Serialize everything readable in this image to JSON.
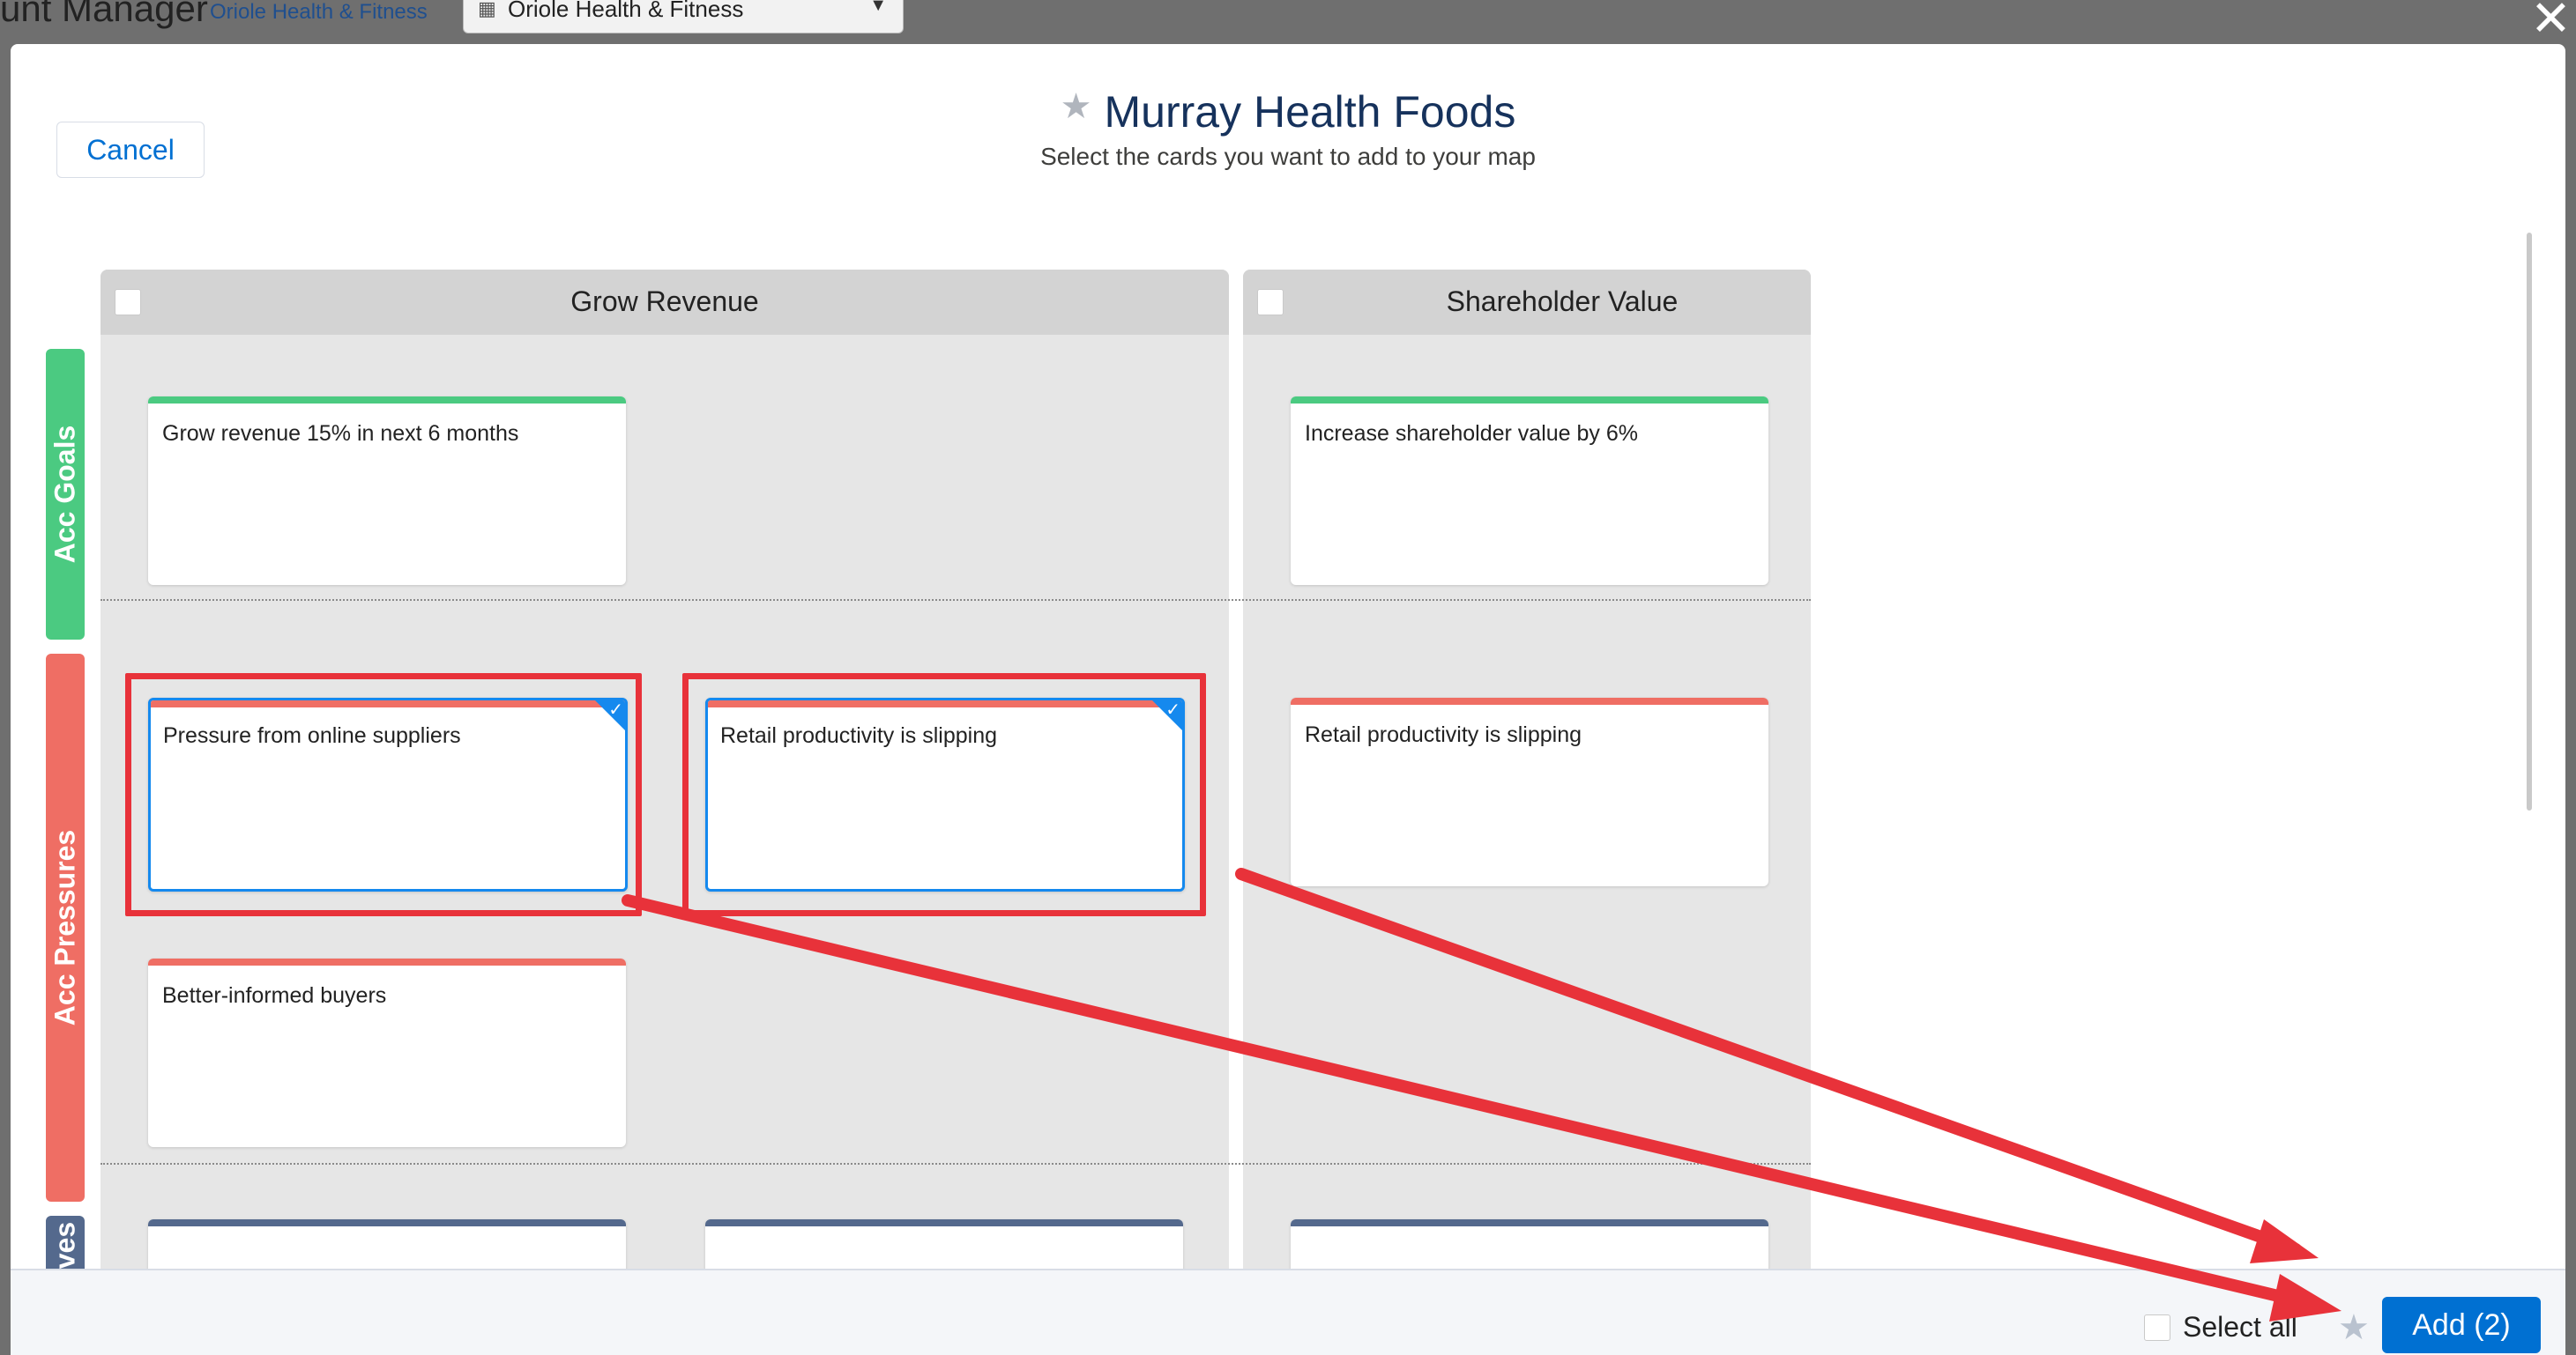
{
  "background": {
    "app_title": "unt Manager",
    "account_link": "Oriole Health & Fitness",
    "account_select": "Oriole Health & Fitness"
  },
  "modal": {
    "cancel_label": "Cancel",
    "title": "Murray Health Foods",
    "subtitle": "Select the cards you want to add to your map"
  },
  "columns": [
    {
      "title": "Grow Revenue"
    },
    {
      "title": "Shareholder Value"
    }
  ],
  "rows": [
    {
      "label": "Acc Goals",
      "color": "#4bca81"
    },
    {
      "label": "Acc Pressures",
      "color": "#ef6e64"
    },
    {
      "label": "ives",
      "color": "#54698d"
    }
  ],
  "cards": {
    "grow_revenue_goal": "Grow revenue 15% in next 6 months",
    "shareholder_goal": "Increase shareholder value by 6%",
    "pressure_online": "Pressure from online suppliers",
    "pressure_retail_1": "Retail productivity is slipping",
    "pressure_retail_2": "Retail productivity is slipping",
    "pressure_buyers": "Better-informed buyers"
  },
  "footer": {
    "select_all_label": "Select all",
    "add_label": "Add (2)"
  },
  "colors": {
    "accent": "#0070d2",
    "selected_border": "#1589ee",
    "annotation_red": "#e8323a"
  }
}
